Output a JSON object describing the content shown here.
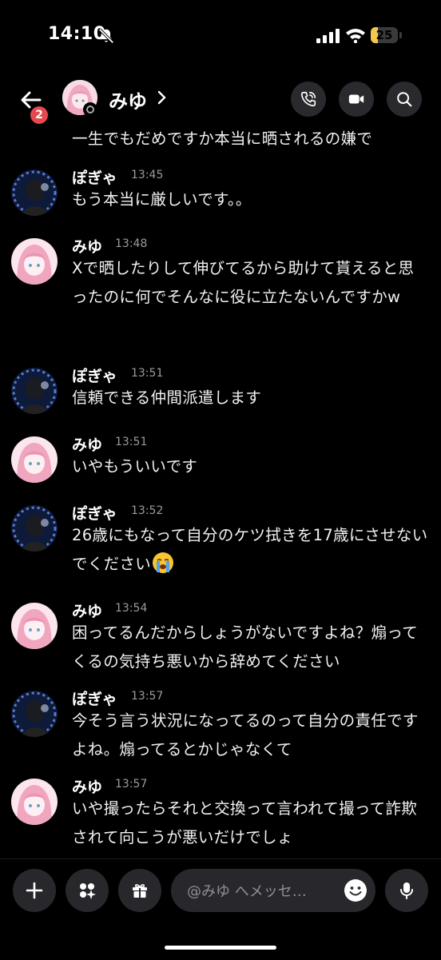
{
  "status": {
    "time": "14:10",
    "battery": "25",
    "battery_level": 0.25
  },
  "header": {
    "name": "みゆ",
    "chevron": "›",
    "unread_badge": "2"
  },
  "messages": {
    "partial_text": "一生でもだめですか本当に晒されるの嫌で",
    "items": [
      {
        "user": "ぽぎゃ",
        "time": "13:45",
        "text": "もう本当に厳しいです。。",
        "avatar": "pogya-avatar"
      },
      {
        "user": "みゆ",
        "time": "13:48",
        "text": "Xで晒したりして伸びてるから助けて貰えると思ったのに何でそんなに役に立たないんですかw",
        "avatar": "miyu-avatar"
      },
      {
        "user": "ぽぎゃ",
        "time": "13:51",
        "text": "信頼できる仲間派遣します",
        "avatar": "pogya-avatar"
      },
      {
        "user": "みゆ",
        "time": "13:51",
        "text": "いやもういいです",
        "avatar": "miyu-avatar"
      },
      {
        "user": "ぽぎゃ",
        "time": "13:52",
        "text": "26歳にもなって自分のケツ拭きを17歳にさせないでください",
        "emoji": "loudly-crying-face",
        "avatar": "pogya-avatar"
      },
      {
        "user": "みゆ",
        "time": "13:54",
        "text": "困ってるんだからしょうがないですよね？煽ってくるの気持ち悪いから辞めてください",
        "avatar": "miyu-avatar"
      },
      {
        "user": "ぽぎゃ",
        "time": "13:57",
        "text": "今そう言う状況になってるのって自分の責任ですよね。煽ってるとかじゃなくて",
        "avatar": "pogya-avatar"
      },
      {
        "user": "みゆ",
        "time": "13:57",
        "text": "いや撮ったらそれと交換って言われて撮って詐欺されて向こうが悪いだけでしょ",
        "avatar": "miyu-avatar"
      }
    ]
  },
  "composer": {
    "placeholder": "@みゆ へメッセ…"
  },
  "colors": {
    "background": "#000000",
    "badge": "#e5484d",
    "battery": "#f2c94c",
    "button_bg": "#28282c"
  }
}
